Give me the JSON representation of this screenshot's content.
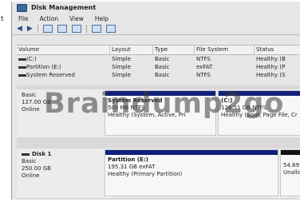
{
  "stray_text": "t",
  "window": {
    "title": "Disk Management",
    "menu": [
      "File",
      "Action",
      "View",
      "Help"
    ]
  },
  "toolbar": {
    "icons": [
      "back-arrow-icon",
      "forward-arrow-icon",
      "console-icon",
      "properties-icon",
      "help-icon",
      "disk-list-icon",
      "settings-icon"
    ]
  },
  "volume_table": {
    "columns": [
      "Volume",
      "Layout",
      "Type",
      "File System",
      "Status"
    ],
    "rows": [
      [
        "(C:)",
        "Simple",
        "Basic",
        "NTFS",
        "Healthy (B"
      ],
      [
        "Partition (E:)",
        "Simple",
        "Basic",
        "exFAT",
        "Healthy (P"
      ],
      [
        "System Reserved",
        "Simple",
        "Basic",
        "NTFS",
        "Healthy (S"
      ]
    ]
  },
  "disks": [
    {
      "lines": [
        "Basic",
        "127.00 GB",
        "Online"
      ],
      "partitions": [
        {
          "name": "System Reserved",
          "size": "500 MB NTFS",
          "status": "Healthy (System, Active, Pri"
        },
        {
          "name": "(C:)",
          "size": "126.51 GB NTFS",
          "status": "Healthy (Boot, Page File, Cr"
        }
      ]
    },
    {
      "name": "Disk 1",
      "lines": [
        "Basic",
        "250.00 GB",
        "Online"
      ],
      "partitions": [
        {
          "name": "Partition (E:)",
          "size": "195.31 GB exFAT",
          "status": "Healthy (Primary Partition)"
        },
        {
          "size": "54.69 GB",
          "status": "Unalloc"
        }
      ]
    }
  ],
  "watermark": "Braindump2go"
}
